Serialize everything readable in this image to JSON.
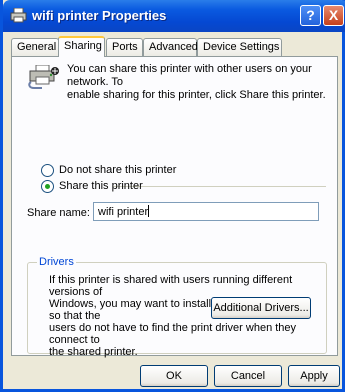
{
  "window": {
    "title": "wifi printer Properties"
  },
  "title_buttons": {
    "help": "?",
    "close": "X"
  },
  "tabs": [
    {
      "label": "General",
      "active": false
    },
    {
      "label": "Sharing",
      "active": true
    },
    {
      "label": "Ports",
      "active": false
    },
    {
      "label": "Advanced",
      "active": false
    },
    {
      "label": "Device Settings",
      "active": false
    }
  ],
  "sharing": {
    "info_line1": "You can share this printer with other users on your network.  To",
    "info_line2": "enable sharing for this printer, click Share this printer.",
    "do_not_share_label": "Do not share this printer",
    "share_label": "Share this printer",
    "selected": "share",
    "share_name_label": "Share name:",
    "share_name_value": "wifi printer"
  },
  "drivers": {
    "legend": "Drivers",
    "text_line1": "If this printer is shared with users running different versions of",
    "text_line2": "Windows, you may want to install additional drivers, so that the",
    "text_line3": "users do not have to find the print driver when they connect to",
    "text_line4": "the shared printer.",
    "button": "Additional Drivers..."
  },
  "buttons": {
    "ok": "OK",
    "cancel": "Cancel",
    "apply": "Apply"
  },
  "icons": {
    "title": "printer-icon",
    "info": "shared-printer-icon"
  },
  "colors": {
    "title_bar": "#0548d2",
    "legend": "#0046d5",
    "selected_radio": "#21a121",
    "active_tab_highlight": "#ffc83c"
  }
}
